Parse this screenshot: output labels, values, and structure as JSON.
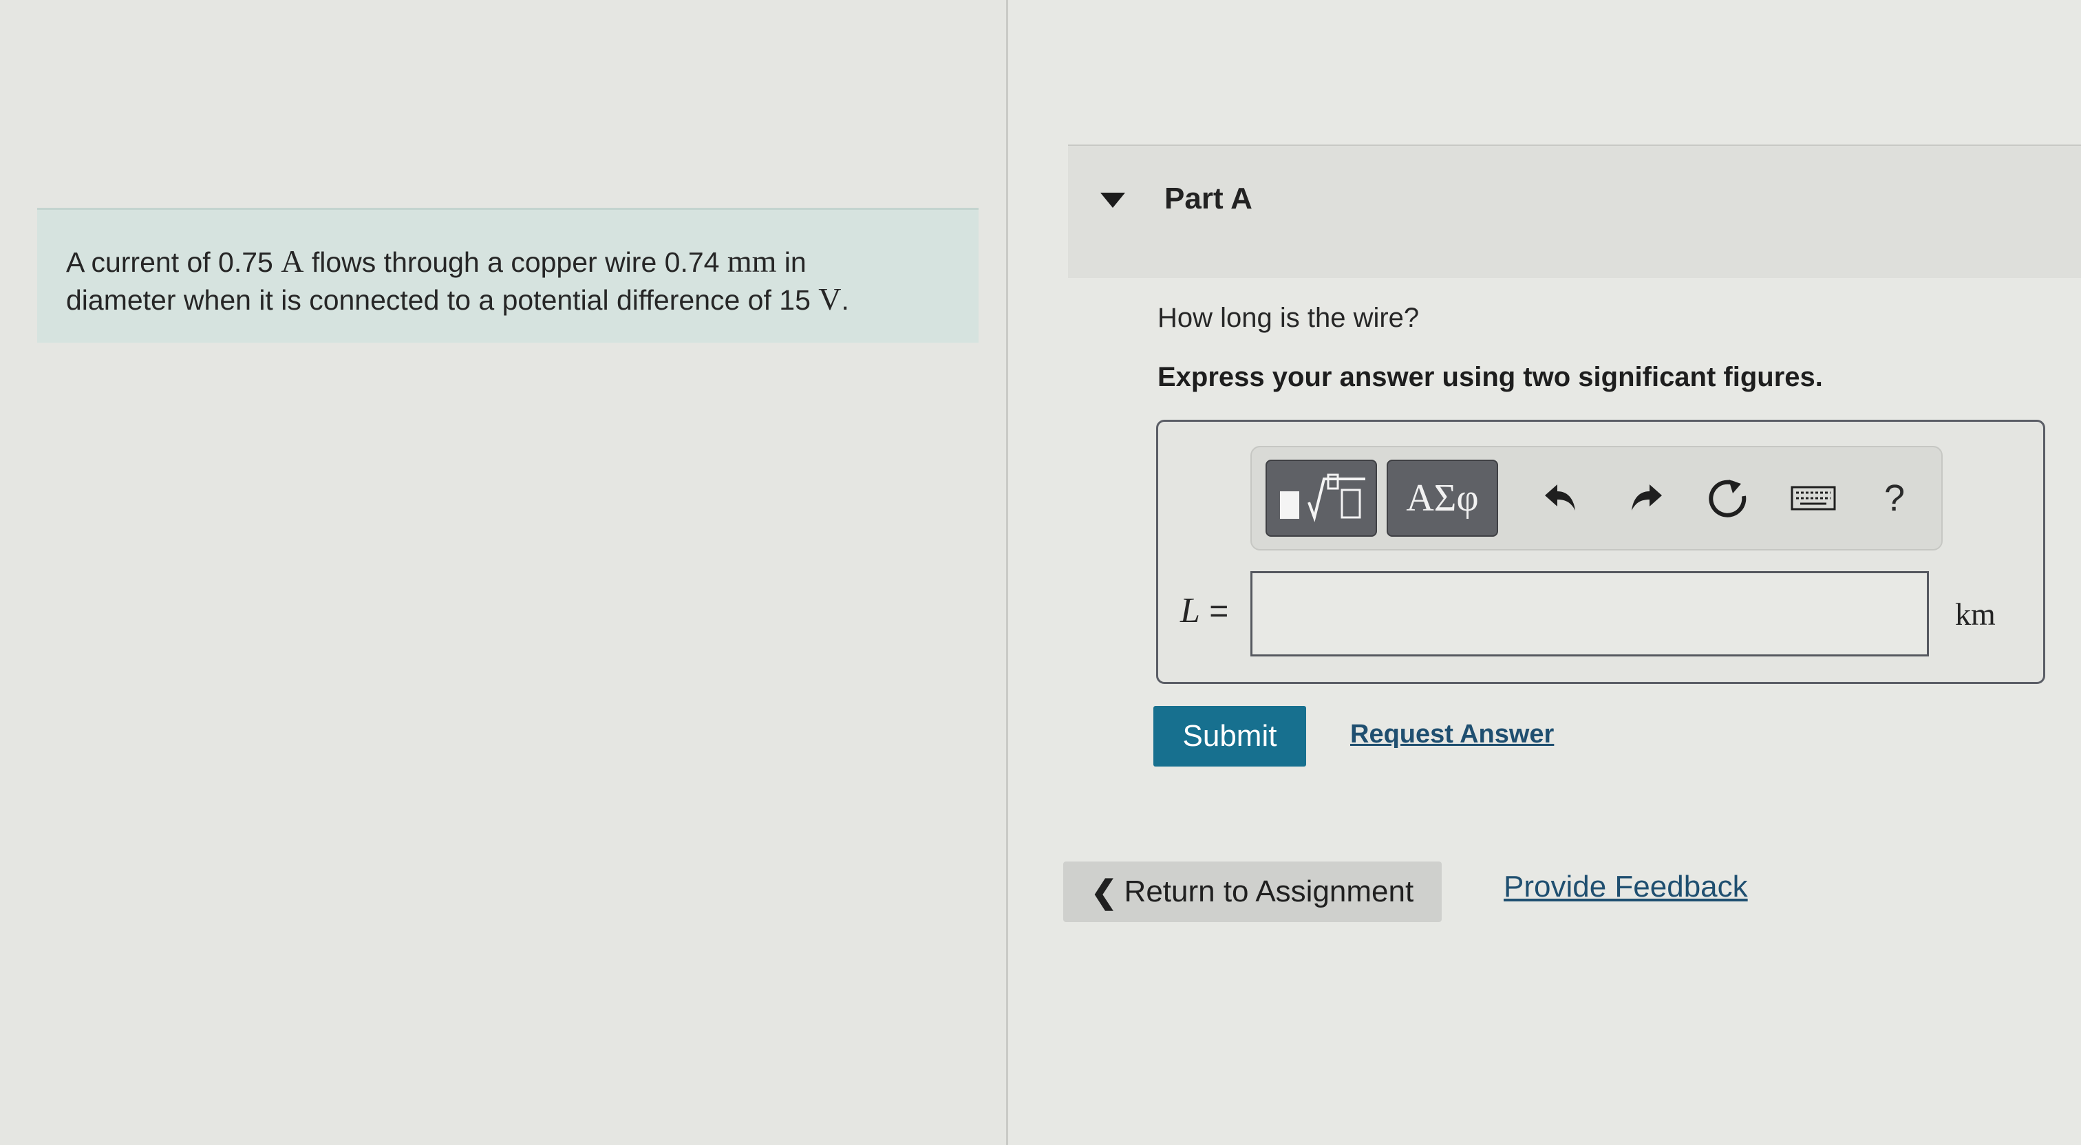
{
  "problem": {
    "line1_pre": "A current of 0.75 ",
    "unit_current": "A",
    "line1_mid": " flows through a copper wire 0.74 ",
    "unit_length": "mm",
    "line1_post": " in",
    "line2_pre": "diameter when it is connected to a potential difference of 15 ",
    "unit_voltage": "V",
    "line2_post": "."
  },
  "part": {
    "title": "Part A",
    "question": "How long is the wire?",
    "instruction": "Express your answer using two significant figures."
  },
  "toolbar": {
    "templates_icon": "fraction-sqrt-templates-icon",
    "symbols_label": "ΑΣφ",
    "undo_icon": "undo-icon",
    "redo_icon": "redo-icon",
    "reset_icon": "reset-icon",
    "keyboard_icon": "keyboard-icon",
    "help_label": "?"
  },
  "answer": {
    "variable": "L",
    "equals": "=",
    "value": "",
    "unit": "km"
  },
  "actions": {
    "submit_label": "Submit",
    "request_answer_label": "Request Answer",
    "return_label": "Return to Assignment",
    "feedback_label": "Provide Feedback"
  },
  "colors": {
    "submit_bg": "#17708f",
    "link": "#1f4f70",
    "problem_bg": "#d6e3df"
  }
}
